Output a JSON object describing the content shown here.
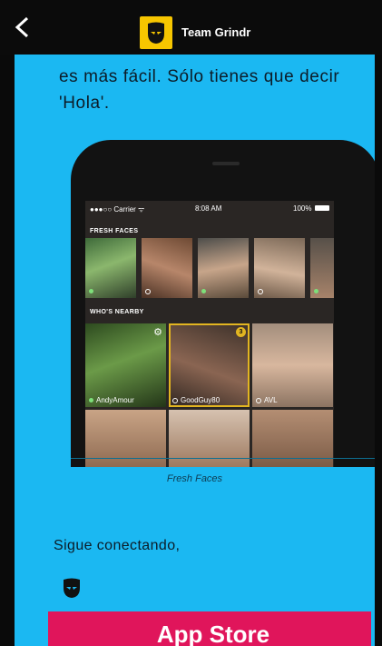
{
  "header": {
    "title": "Team Grindr"
  },
  "message": {
    "intro": "es más fácil. Sólo tienes que decir 'Hola'.",
    "signoff": "Sigue conectando,"
  },
  "phone": {
    "status": {
      "carrier": "●●●○○ Carrier ᯤ",
      "time": "8:08 AM",
      "battery": "100%"
    },
    "fresh_faces_label": "FRESH FACES",
    "whos_nearby_label": "WHO'S NEARBY",
    "nearby": [
      {
        "name": "AndyAmour"
      },
      {
        "name": "GoodGuy80",
        "badge": "3"
      },
      {
        "name": "AVL"
      }
    ]
  },
  "image_caption": "Fresh Faces",
  "cta": {
    "label": "App Store"
  },
  "colors": {
    "background": "#1bb8f2",
    "brand_yellow": "#f7c600",
    "cta": "#e0155b"
  }
}
